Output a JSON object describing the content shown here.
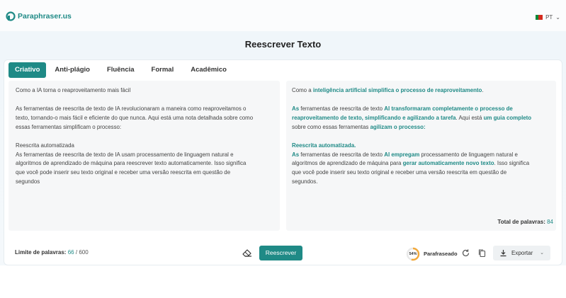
{
  "brand": {
    "name": "Paraphraser.us",
    "accent": "#1f8a86"
  },
  "language": {
    "code": "PT"
  },
  "page": {
    "title": "Reescrever Texto"
  },
  "tabs": [
    {
      "label": "Criativo",
      "active": true
    },
    {
      "label": "Anti-plágio",
      "active": false
    },
    {
      "label": "Fluência",
      "active": false
    },
    {
      "label": "Formal",
      "active": false
    },
    {
      "label": "Acadêmico",
      "active": false
    }
  ],
  "input": {
    "lines": [
      [
        "Como a IA torna o reaproveitamento mais fácil"
      ],
      [
        "As ferramentas de reescrita de texto de IA revolucionaram a maneira como reaproveitamos o",
        "texto, tornando-o mais fácil e eficiente do que nunca. Aqui está uma nota detalhada sobre como",
        "essas ferramentas simplificam o processo:"
      ],
      [
        "Reescrita automatizada",
        "As ferramentas de reescrita de texto de IA usam processamento de linguagem natural e",
        "algoritmos de aprendizado de máquina para reescrever texto automaticamente. Isso significa",
        "que você pode inserir seu texto original e receber uma versão reescrita em questão de",
        "segundos"
      ]
    ]
  },
  "output": {
    "p1": {
      "a": "Como a ",
      "b": "inteligência artificial simplifica o processo de reaproveitamento",
      "c": "."
    },
    "p2l1": {
      "a": "As",
      "b": " ferramentas de reescrita de texto ",
      "c": "AI transformaram completamente o processo de"
    },
    "p2l2": {
      "a": "reaproveitamento de texto, simplificando e agilizando a tarefa",
      "b": ". Aqui está ",
      "c": "um guia completo"
    },
    "p2l3": {
      "a": "sobre como essas ferramentas ",
      "b": "agilizam o processo:"
    },
    "p3l1": {
      "a": "Reescrita automatizada."
    },
    "p3l2": {
      "a": "As",
      "b": " ferramentas de reescrita de texto ",
      "c": "AI empregam",
      "d": " processamento de linguagem natural e"
    },
    "p3l3": {
      "a": "algoritmos de aprendizado de máquina para ",
      "b": "gerar automaticamente novo texto",
      "c": ". Isso significa"
    },
    "p3l4": {
      "a": "que você pode inserir seu texto original e receber uma versão reescrita em questão de"
    },
    "p3l5": {
      "a": "segundos."
    },
    "total_label": "Total de palavras:",
    "total_value": "84"
  },
  "footer": {
    "limit_label": "Limite de palavras:",
    "limit_used": "66",
    "limit_max": "600",
    "rewrite_label": "Reescrever",
    "paraphrased_percent": "54%",
    "paraphrased_fraction": 0.54,
    "paraphrased_label": "Parafraseado",
    "export_label": "Exportar"
  }
}
